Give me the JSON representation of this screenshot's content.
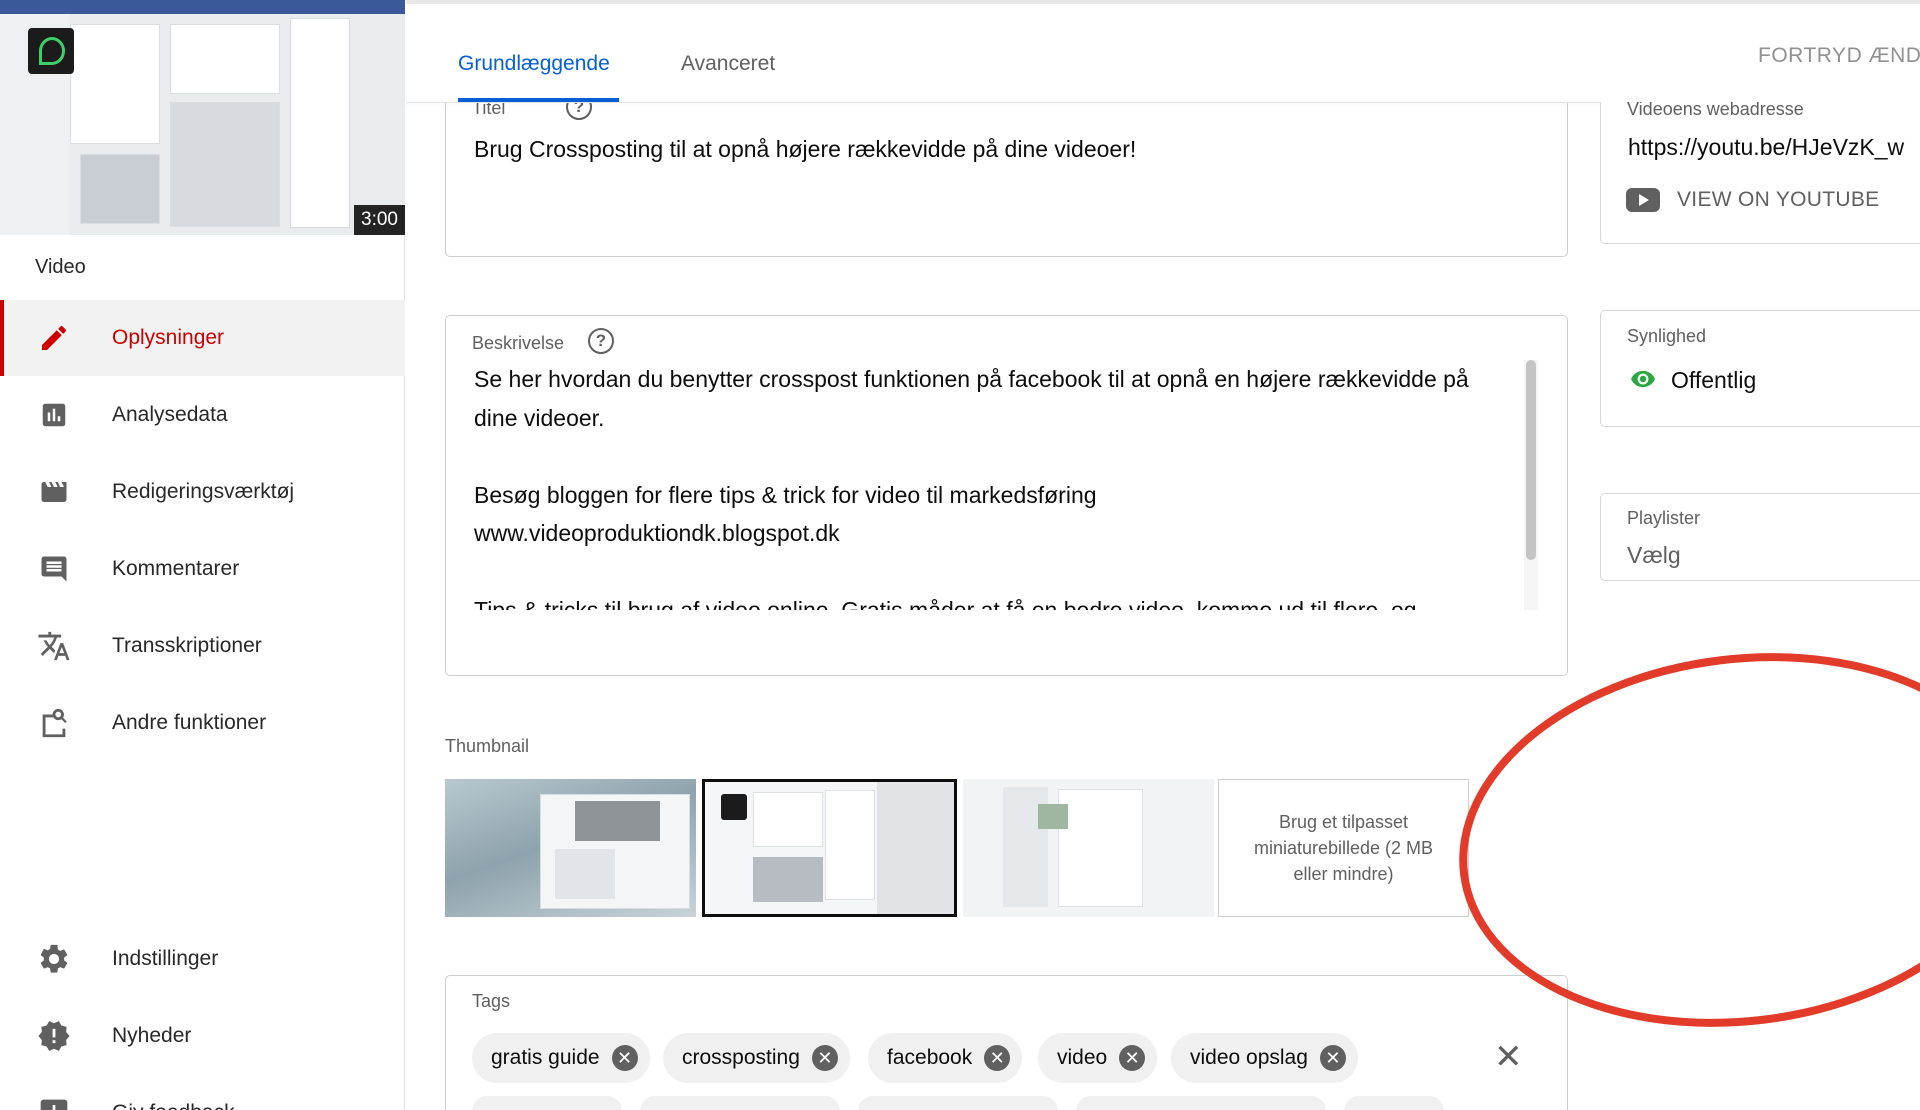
{
  "sidebar": {
    "video_duration": "3:00",
    "heading": "Video",
    "items": [
      {
        "label": "Oplysninger",
        "icon": "pencil-icon",
        "active": true
      },
      {
        "label": "Analysedata",
        "icon": "analytics-icon"
      },
      {
        "label": "Redigeringsværktøj",
        "icon": "clapperboard-icon"
      },
      {
        "label": "Kommentarer",
        "icon": "comment-icon"
      },
      {
        "label": "Transskriptioner",
        "icon": "translate-icon"
      },
      {
        "label": "Andre funktioner",
        "icon": "other-features-icon"
      }
    ],
    "bottom_items": [
      {
        "label": "Indstillinger",
        "icon": "gear-icon"
      },
      {
        "label": "Nyheder",
        "icon": "news-alert-icon"
      },
      {
        "label": "Giv feedback",
        "icon": "feedback-icon"
      }
    ]
  },
  "header": {
    "tabs": [
      {
        "label": "Grundlæggende",
        "active": true
      },
      {
        "label": "Avanceret"
      }
    ],
    "undo_label": "FORTRYD ÆNDR"
  },
  "form": {
    "title_label": "Titel",
    "title_value": "Brug Crossposting til at opnå højere rækkevidde på dine videoer!",
    "description_label": "Beskrivelse",
    "description_lines": [
      "Se her hvordan du benytter crosspost funktionen på facebook til at opnå en højere rækkevidde på",
      "dine videoer.",
      "",
      "Besøg bloggen for flere tips & trick for video til markedsføring",
      "www.videoproduktiondk.blogspot.dk",
      "",
      "Tips & tricks til brug af video online. Gratis måder at få en bedre video, komme ud til flere, og"
    ],
    "thumbnail_label": "Thumbnail",
    "thumbnail_upload_label": "Brug et tilpasset miniaturebillede (2 MB eller mindre)",
    "tags_label": "Tags",
    "tags": [
      "gratis guide",
      "crossposting",
      "facebook",
      "video",
      "video opslag"
    ]
  },
  "right": {
    "video_url_label": "Videoens webadresse",
    "video_url": "https://youtu.be/HJeVzK_w",
    "view_on_youtube": "VIEW ON YOUTUBE",
    "visibility_label": "Synlighed",
    "visibility_value": "Offentlig",
    "playlists_label": "Playlister",
    "playlists_value": "Vælg"
  },
  "colors": {
    "accent_blue": "#065fd4",
    "active_red": "#cc0000",
    "annotation_red": "#e23b2a",
    "visibility_green": "#2ba640"
  }
}
